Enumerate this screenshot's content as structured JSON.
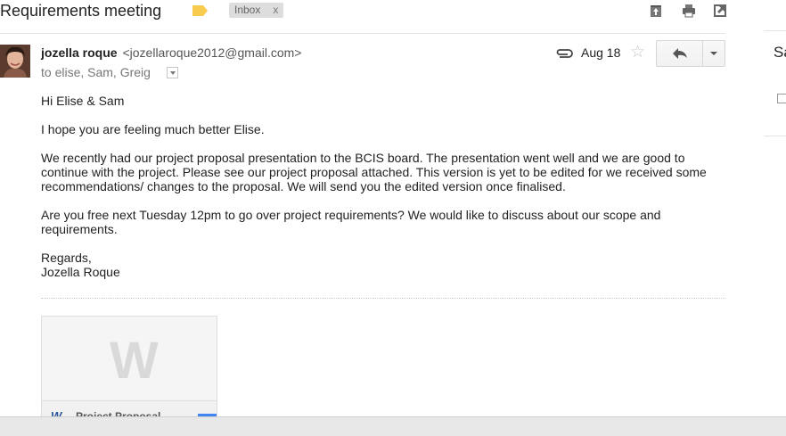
{
  "header": {
    "subject": "Requirements meeting",
    "inbox_chip": "Inbox",
    "inbox_chip_close": "x",
    "label_color": "#f7cb4d"
  },
  "message": {
    "sender_name": "jozella roque",
    "sender_email": "<jozellaroque2012@gmail.com>",
    "recipients": "to elise, Sam, Greig",
    "date": "Aug 18",
    "star_glyph": "☆"
  },
  "body": {
    "greeting": "Hi Elise & Sam",
    "p1": "I hope you are feeling much better Elise.",
    "p2": "We recently had our project proposal presentation to the BCIS board. The presentation went well and we are good to continue with the project. Please see our project proposal attached. This version is yet to be edited for we received some recommendations/ changes to the proposal. We will send you the edited version once finalised.",
    "p3": "Are you free next Tuesday 12pm to go over project requirements? We would like to discuss about our scope and requirements.",
    "signoff": "Regards,",
    "signature": "Jozella Roque"
  },
  "attachment": {
    "thumb_glyph": "W",
    "type_icon": "W",
    "name": "Project Proposal",
    "accent_color": "#4285f4"
  },
  "right_panel": {
    "text": "Sa"
  }
}
